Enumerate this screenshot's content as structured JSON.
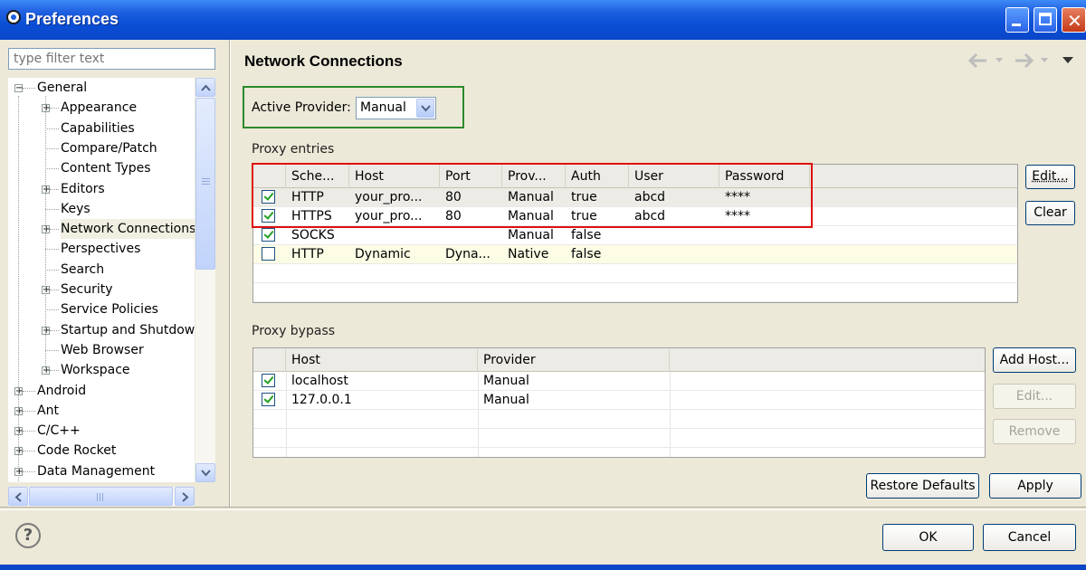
{
  "window": {
    "title": "Preferences"
  },
  "filter": {
    "placeholder": "type filter text"
  },
  "tree": {
    "items": [
      {
        "label": "General",
        "expander": "minus"
      },
      {
        "label": "Appearance",
        "expander": "plus"
      },
      {
        "label": "Capabilities",
        "expander": ""
      },
      {
        "label": "Compare/Patch",
        "expander": ""
      },
      {
        "label": "Content Types",
        "expander": ""
      },
      {
        "label": "Editors",
        "expander": "plus"
      },
      {
        "label": "Keys",
        "expander": ""
      },
      {
        "label": "Network Connections",
        "expander": "plus",
        "selected": true
      },
      {
        "label": "Perspectives",
        "expander": ""
      },
      {
        "label": "Search",
        "expander": ""
      },
      {
        "label": "Security",
        "expander": "plus"
      },
      {
        "label": "Service Policies",
        "expander": ""
      },
      {
        "label": "Startup and Shutdown",
        "expander": "plus"
      },
      {
        "label": "Web Browser",
        "expander": ""
      },
      {
        "label": "Workspace",
        "expander": "plus"
      },
      {
        "label": "Android",
        "expander": "plus"
      },
      {
        "label": "Ant",
        "expander": "plus"
      },
      {
        "label": "C/C++",
        "expander": "plus"
      },
      {
        "label": "Code Rocket",
        "expander": "plus"
      },
      {
        "label": "Data Management",
        "expander": "plus"
      }
    ]
  },
  "page": {
    "title": "Network Connections"
  },
  "provider": {
    "label": "Active Provider:",
    "value": "Manual"
  },
  "proxy_entries": {
    "label": "Proxy entries",
    "columns": [
      "Sche...",
      "Host",
      "Port",
      "Prov...",
      "Auth",
      "User",
      "Password"
    ],
    "rows": [
      {
        "checked": true,
        "cells": [
          "HTTP",
          "your_pro...",
          "80",
          "Manual",
          "true",
          "abcd",
          "****"
        ]
      },
      {
        "checked": true,
        "cells": [
          "HTTPS",
          "your_pro...",
          "80",
          "Manual",
          "true",
          "abcd",
          "****"
        ]
      },
      {
        "checked": true,
        "cells": [
          "SOCKS",
          "",
          "",
          "Manual",
          "false",
          "",
          ""
        ]
      },
      {
        "checked": false,
        "cells": [
          "HTTP",
          "Dynamic",
          "Dyna...",
          "Native",
          "false",
          "",
          ""
        ]
      }
    ],
    "edit_button": "Edit...",
    "clear_button": "Clear"
  },
  "proxy_bypass": {
    "label": "Proxy bypass",
    "columns": [
      "Host",
      "Provider"
    ],
    "rows": [
      {
        "checked": true,
        "cells": [
          "localhost",
          "Manual"
        ]
      },
      {
        "checked": true,
        "cells": [
          "127.0.0.1",
          "Manual"
        ]
      }
    ],
    "add_host_button": "Add Host...",
    "edit_button": "Edit...",
    "remove_button": "Remove"
  },
  "buttons": {
    "restore_defaults": "Restore Defaults",
    "apply": "Apply",
    "ok": "OK",
    "cancel": "Cancel"
  },
  "icons": {
    "help": "?"
  },
  "colors": {
    "titlebar": "#0a4fd6",
    "provider_highlight": "#2b8a2b",
    "entries_highlight": "#e01010",
    "check": "#21a121"
  }
}
